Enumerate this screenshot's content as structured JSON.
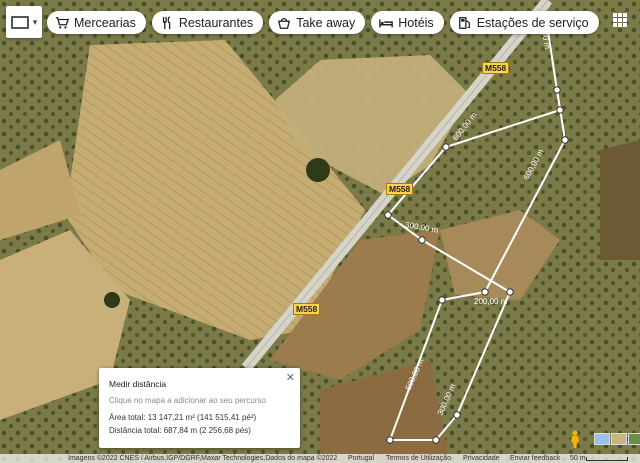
{
  "chips": [
    {
      "label": "Mercearias",
      "icon": "cart-icon"
    },
    {
      "label": "Restaurantes",
      "icon": "cutlery-icon"
    },
    {
      "label": "Take away",
      "icon": "takeaway-icon"
    },
    {
      "label": "Hotéis",
      "icon": "bed-icon"
    },
    {
      "label": "Estações de serviço",
      "icon": "fuel-icon"
    }
  ],
  "roads": [
    "M558",
    "M558",
    "M558"
  ],
  "segments": [
    "600,00 m",
    "600,00 m",
    "600,00 m",
    "300,00 m",
    "200,00 m",
    "500,00 m",
    "300,00 m"
  ],
  "panel": {
    "title": "Medir distância",
    "hint": "Clique no mapa a adicionar ao seu percurso",
    "area": "Área total: 13 147,21 m² (141 515,41 pé²)",
    "distance": "Distância total: 687,84 m (2 256,68 pés)"
  },
  "footer": {
    "imagery": "Imagens ©2022 CNES / Airbus,IGP/DGRF,Maxar Technologies,Dados do mapa ©2022",
    "country": "Portugal",
    "terms": "Termos de Utilização",
    "privacy": "Privacidade",
    "feedback": "Enviar feedback",
    "scale": "50 m"
  }
}
